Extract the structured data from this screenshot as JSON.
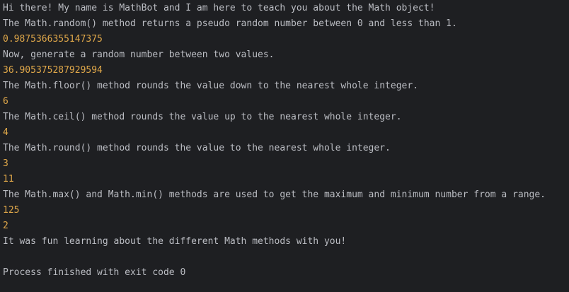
{
  "console": {
    "lines": [
      "Hi there! My name is MathBot and I am here to teach you about the Math object!",
      "The Math.random() method returns a pseudo random number between 0 and less than 1.",
      "0.9875366355147375",
      "Now, generate a random number between two values.",
      "36.905375287929594",
      "The Math.floor() method rounds the value down to the nearest whole integer.",
      "6",
      "The Math.ceil() method rounds the value up to the nearest whole integer.",
      "4",
      "The Math.round() method rounds the value to the nearest whole integer.",
      "3",
      "11",
      "The Math.max() and Math.min() methods are used to get the maximum and minimum number from a range.",
      "125",
      "2",
      "It was fun learning about the different Math methods with you!",
      "",
      "Process finished with exit code 0"
    ]
  },
  "colors": {
    "background": "#1e1f22",
    "text": "#bcbec4",
    "number": "#e0a84a"
  }
}
